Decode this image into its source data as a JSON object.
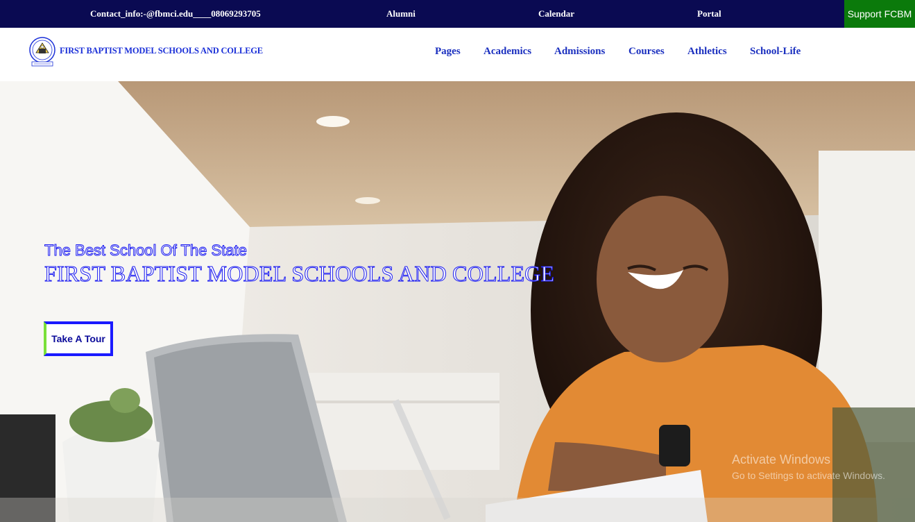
{
  "topbar": {
    "contact": "Contact_info:-@fbmci.edu____08069293705",
    "alumni": "Alumni",
    "calendar": "Calendar",
    "portal": "Portal",
    "support": "Support FCBM",
    "background": "#0a0a52",
    "support_color": "#0b7a0b"
  },
  "nav": {
    "brand": "FIRST BAPTIST MODEL SCHOOLS AND COLLEGE",
    "items": [
      "Pages",
      "Academics",
      "Admissions",
      "Courses",
      "Athletics",
      "School-Life"
    ],
    "color": "#1a2fbf"
  },
  "hero": {
    "tagline": "The Best School Of The State",
    "title": "FIRST BAPTIST MODEL SCHOOLS AND COLLEGE",
    "tour_button": "Take A Tour",
    "image": "student-smiling-at-laptop-photo"
  },
  "watermark": {
    "line1": "Activate Windows",
    "line2": "Go to Settings to activate Windows."
  }
}
